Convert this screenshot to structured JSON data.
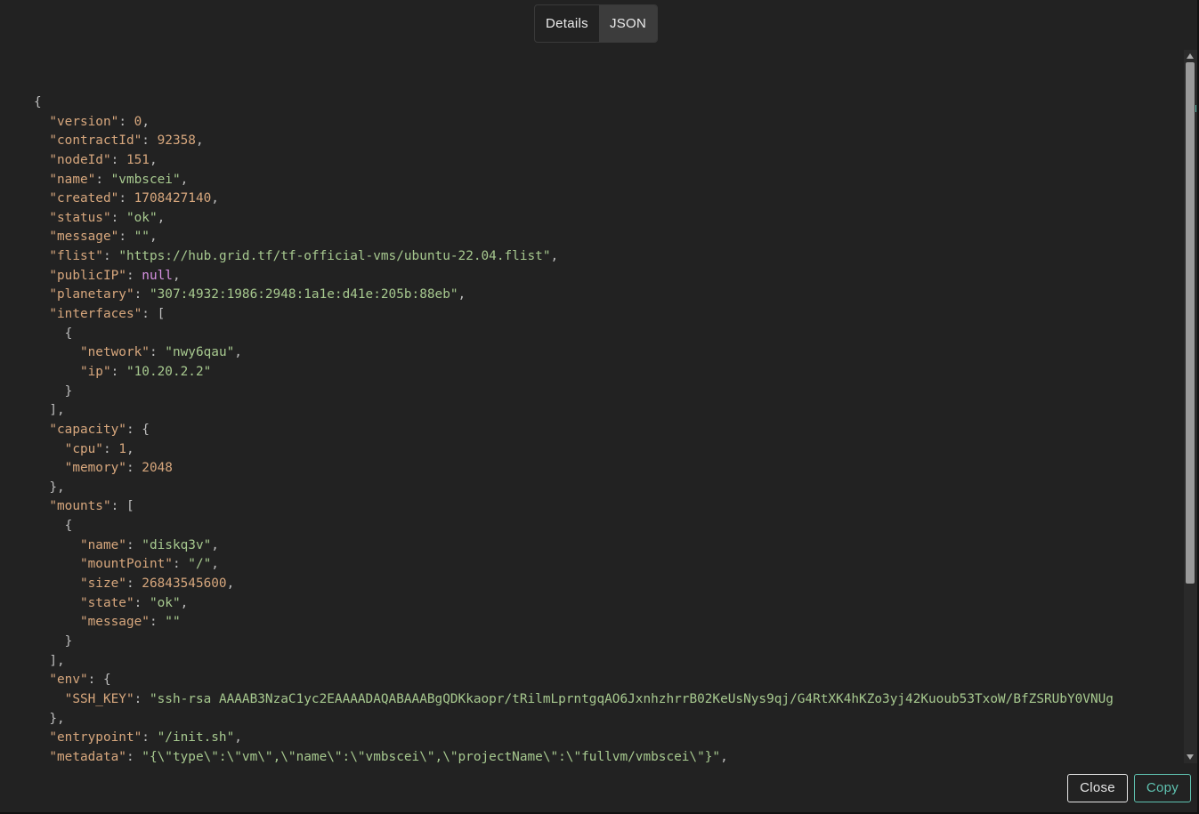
{
  "tabs": [
    {
      "label": "Details",
      "active": false
    },
    {
      "label": "JSON",
      "active": true
    }
  ],
  "json_lines": [
    [
      [
        "p",
        "{"
      ]
    ],
    [
      [
        "p",
        "  "
      ],
      [
        "k",
        "\"version\""
      ],
      [
        "p",
        ": "
      ],
      [
        "n",
        "0"
      ],
      [
        "p",
        ","
      ]
    ],
    [
      [
        "p",
        "  "
      ],
      [
        "k",
        "\"contractId\""
      ],
      [
        "p",
        ": "
      ],
      [
        "n",
        "92358"
      ],
      [
        "p",
        ","
      ]
    ],
    [
      [
        "p",
        "  "
      ],
      [
        "k",
        "\"nodeId\""
      ],
      [
        "p",
        ": "
      ],
      [
        "n",
        "151"
      ],
      [
        "p",
        ","
      ]
    ],
    [
      [
        "p",
        "  "
      ],
      [
        "k",
        "\"name\""
      ],
      [
        "p",
        ": "
      ],
      [
        "s",
        "\"vmbscei\""
      ],
      [
        "p",
        ","
      ]
    ],
    [
      [
        "p",
        "  "
      ],
      [
        "k",
        "\"created\""
      ],
      [
        "p",
        ": "
      ],
      [
        "n",
        "1708427140"
      ],
      [
        "p",
        ","
      ]
    ],
    [
      [
        "p",
        "  "
      ],
      [
        "k",
        "\"status\""
      ],
      [
        "p",
        ": "
      ],
      [
        "s",
        "\"ok\""
      ],
      [
        "p",
        ","
      ]
    ],
    [
      [
        "p",
        "  "
      ],
      [
        "k",
        "\"message\""
      ],
      [
        "p",
        ": "
      ],
      [
        "s",
        "\"\""
      ],
      [
        "p",
        ","
      ]
    ],
    [
      [
        "p",
        "  "
      ],
      [
        "k",
        "\"flist\""
      ],
      [
        "p",
        ": "
      ],
      [
        "s",
        "\"https://hub.grid.tf/tf-official-vms/ubuntu-22.04.flist\""
      ],
      [
        "p",
        ","
      ]
    ],
    [
      [
        "p",
        "  "
      ],
      [
        "k",
        "\"publicIP\""
      ],
      [
        "p",
        ": "
      ],
      [
        "nl",
        "null"
      ],
      [
        "p",
        ","
      ]
    ],
    [
      [
        "p",
        "  "
      ],
      [
        "k",
        "\"planetary\""
      ],
      [
        "p",
        ": "
      ],
      [
        "s",
        "\"307:4932:1986:2948:1a1e:d41e:205b:88eb\""
      ],
      [
        "p",
        ","
      ]
    ],
    [
      [
        "p",
        "  "
      ],
      [
        "k",
        "\"interfaces\""
      ],
      [
        "p",
        ": ["
      ]
    ],
    [
      [
        "p",
        "    {"
      ]
    ],
    [
      [
        "p",
        "      "
      ],
      [
        "k",
        "\"network\""
      ],
      [
        "p",
        ": "
      ],
      [
        "s",
        "\"nwy6qau\""
      ],
      [
        "p",
        ","
      ]
    ],
    [
      [
        "p",
        "      "
      ],
      [
        "k",
        "\"ip\""
      ],
      [
        "p",
        ": "
      ],
      [
        "s",
        "\"10.20.2.2\""
      ]
    ],
    [
      [
        "p",
        "    }"
      ]
    ],
    [
      [
        "p",
        "  ],"
      ]
    ],
    [
      [
        "p",
        "  "
      ],
      [
        "k",
        "\"capacity\""
      ],
      [
        "p",
        ": {"
      ]
    ],
    [
      [
        "p",
        "    "
      ],
      [
        "k",
        "\"cpu\""
      ],
      [
        "p",
        ": "
      ],
      [
        "n",
        "1"
      ],
      [
        "p",
        ","
      ]
    ],
    [
      [
        "p",
        "    "
      ],
      [
        "k",
        "\"memory\""
      ],
      [
        "p",
        ": "
      ],
      [
        "n",
        "2048"
      ]
    ],
    [
      [
        "p",
        "  },"
      ]
    ],
    [
      [
        "p",
        "  "
      ],
      [
        "k",
        "\"mounts\""
      ],
      [
        "p",
        ": ["
      ]
    ],
    [
      [
        "p",
        "    {"
      ]
    ],
    [
      [
        "p",
        "      "
      ],
      [
        "k",
        "\"name\""
      ],
      [
        "p",
        ": "
      ],
      [
        "s",
        "\"diskq3v\""
      ],
      [
        "p",
        ","
      ]
    ],
    [
      [
        "p",
        "      "
      ],
      [
        "k",
        "\"mountPoint\""
      ],
      [
        "p",
        ": "
      ],
      [
        "s",
        "\"/\""
      ],
      [
        "p",
        ","
      ]
    ],
    [
      [
        "p",
        "      "
      ],
      [
        "k",
        "\"size\""
      ],
      [
        "p",
        ": "
      ],
      [
        "n",
        "26843545600"
      ],
      [
        "p",
        ","
      ]
    ],
    [
      [
        "p",
        "      "
      ],
      [
        "k",
        "\"state\""
      ],
      [
        "p",
        ": "
      ],
      [
        "s",
        "\"ok\""
      ],
      [
        "p",
        ","
      ]
    ],
    [
      [
        "p",
        "      "
      ],
      [
        "k",
        "\"message\""
      ],
      [
        "p",
        ": "
      ],
      [
        "s",
        "\"\""
      ]
    ],
    [
      [
        "p",
        "    }"
      ]
    ],
    [
      [
        "p",
        "  ],"
      ]
    ],
    [
      [
        "p",
        "  "
      ],
      [
        "k",
        "\"env\""
      ],
      [
        "p",
        ": {"
      ]
    ],
    [
      [
        "p",
        "    "
      ],
      [
        "k",
        "\"SSH_KEY\""
      ],
      [
        "p",
        ": "
      ],
      [
        "s",
        "\"ssh-rsa AAAAB3NzaC1yc2EAAAADAQABAAABgQDKkaopr/tRilmLprntgqAO6JxnhzhrrB02KeUsNys9qj/G4RtXK4hKZo3yj42Kuoub53TxoW/BfZSRUbY0VNUg"
      ]
    ],
    [
      [
        "p",
        "  },"
      ]
    ],
    [
      [
        "p",
        "  "
      ],
      [
        "k",
        "\"entrypoint\""
      ],
      [
        "p",
        ": "
      ],
      [
        "s",
        "\"/init.sh\""
      ],
      [
        "p",
        ","
      ]
    ],
    [
      [
        "p",
        "  "
      ],
      [
        "k",
        "\"metadata\""
      ],
      [
        "p",
        ": "
      ],
      [
        "s",
        "\"{\\\"type\\\":\\\"vm\\\",\\\"name\\\":\\\"vmbscei\\\",\\\"projectName\\\":\\\"fullvm/vmbscei\\\"}\""
      ],
      [
        "p",
        ","
      ]
    ]
  ],
  "buttons": {
    "close_label": "Close",
    "copy_label": "Copy"
  },
  "colors": {
    "background": "#222222",
    "key": "#d7a77d",
    "string": "#a7c98f",
    "number": "#d7a77d",
    "null": "#d792e3",
    "accent": "#5fc2b0"
  }
}
